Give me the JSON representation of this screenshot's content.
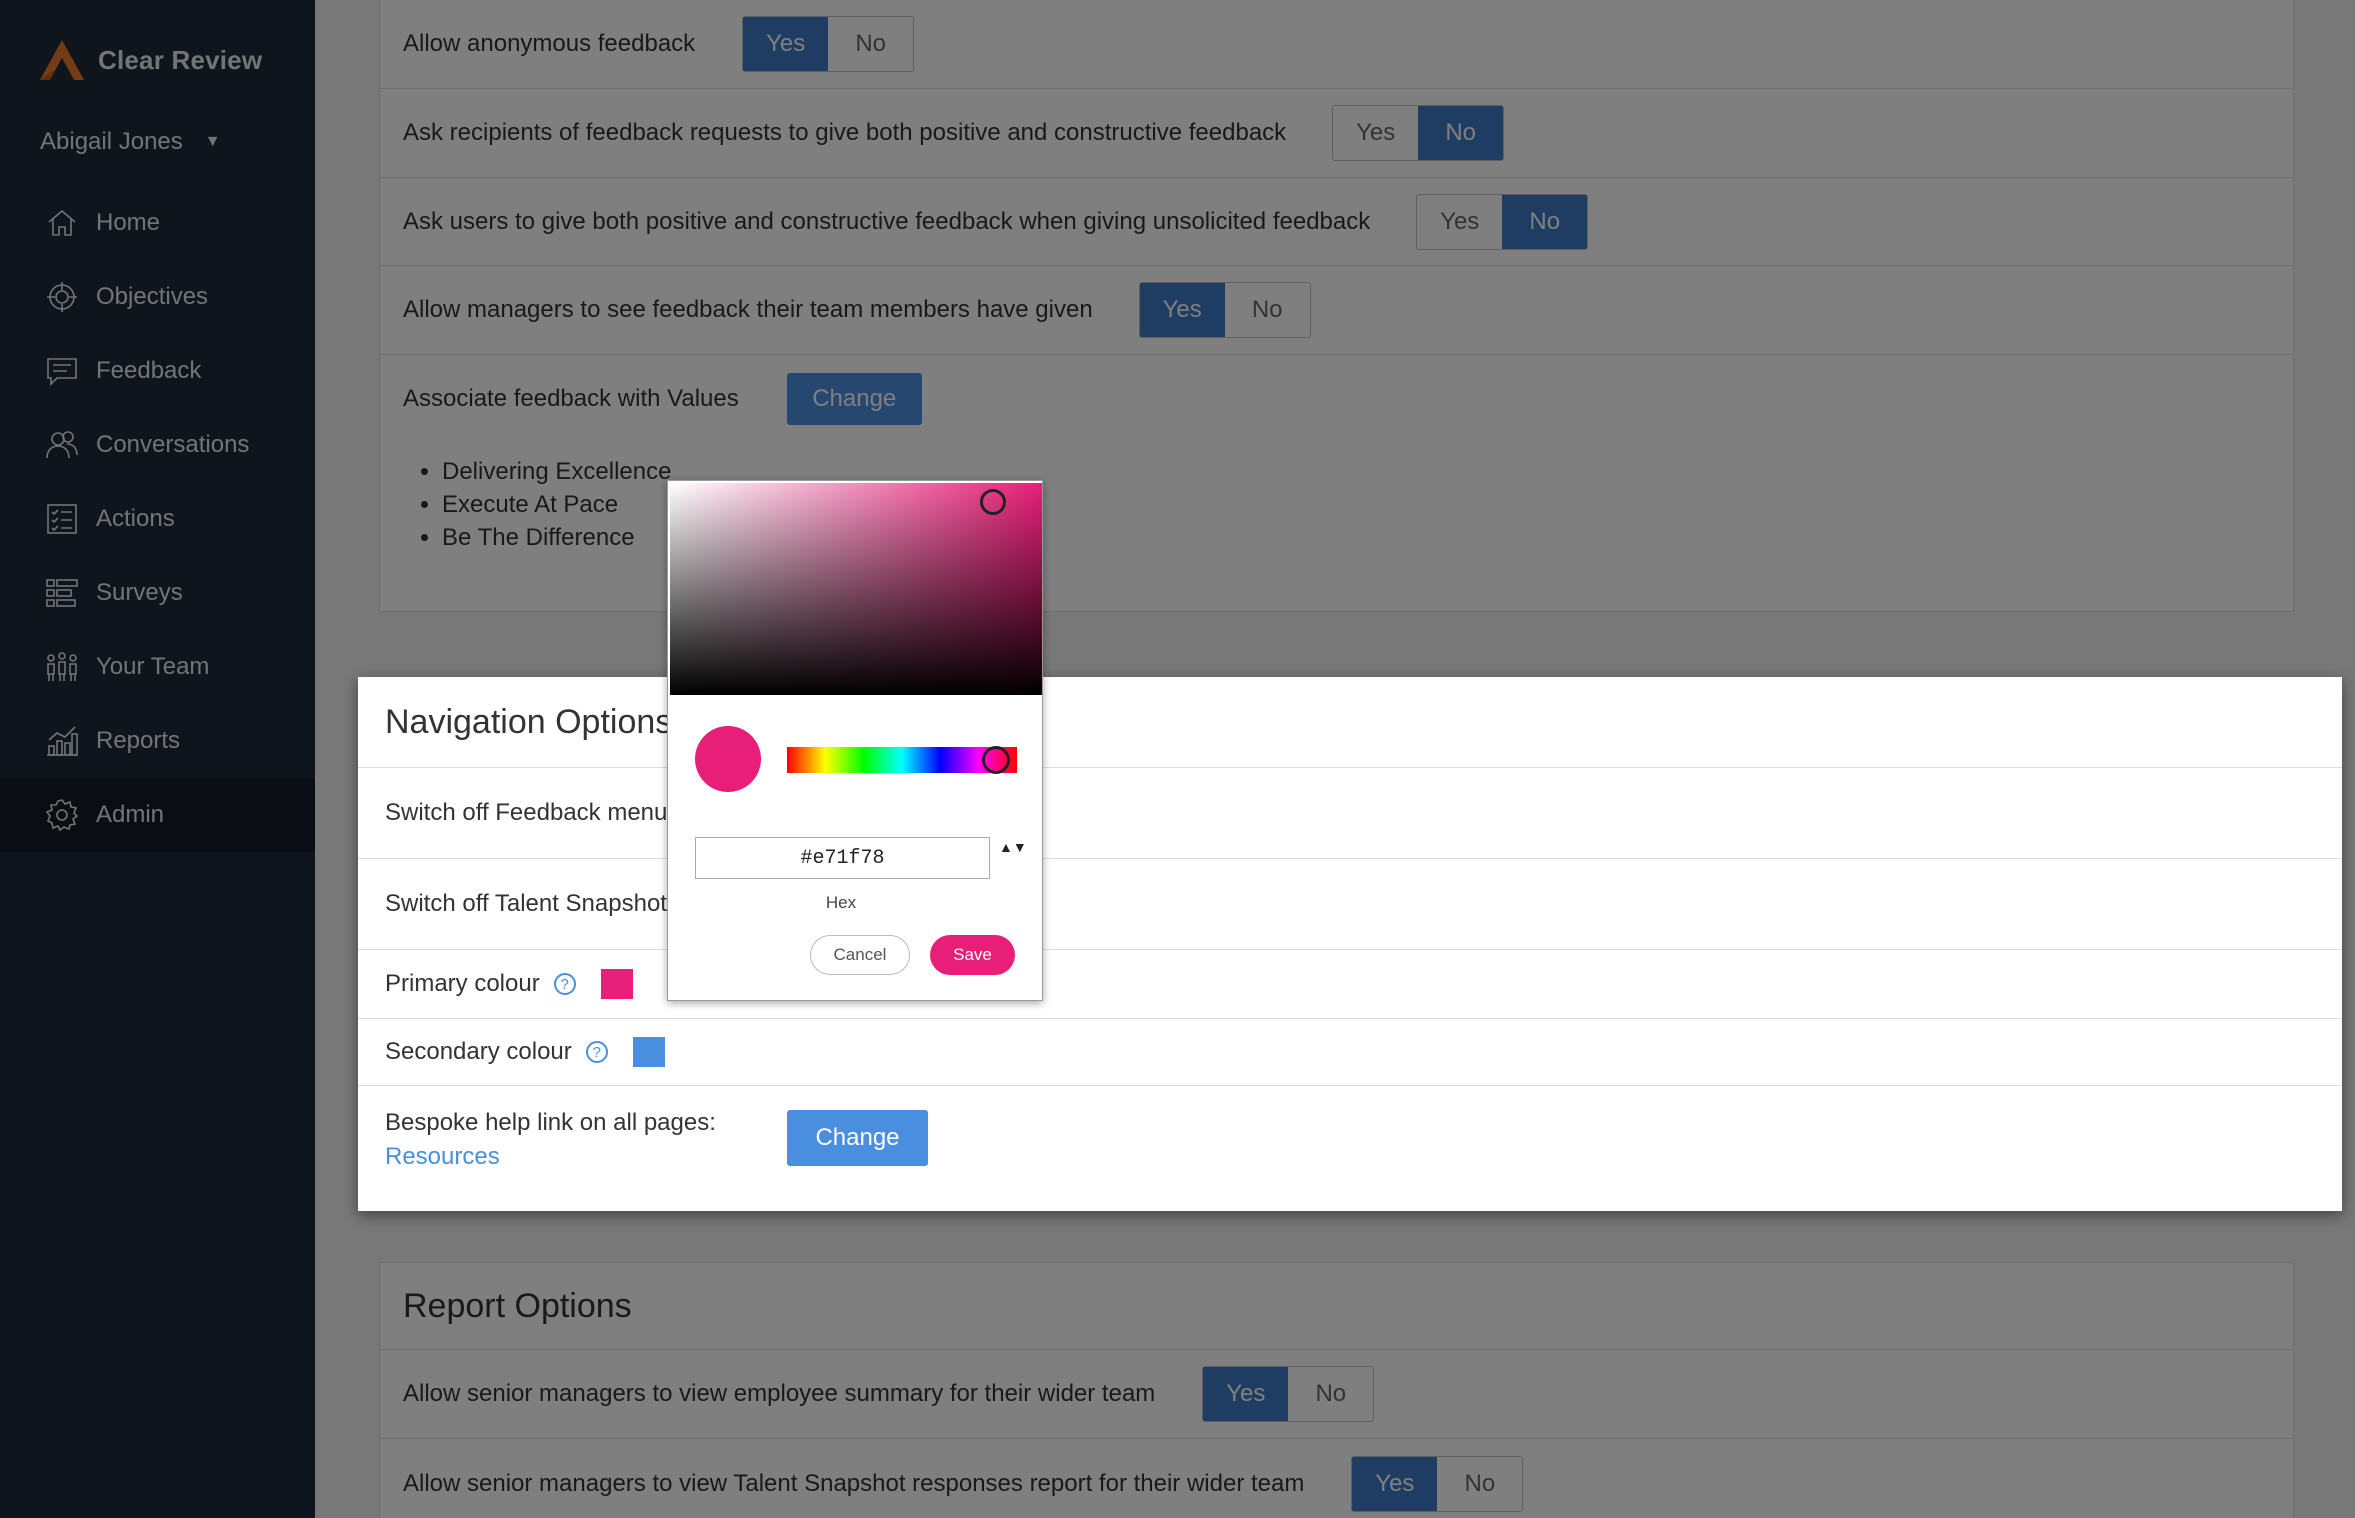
{
  "app": {
    "name": "Clear Review"
  },
  "user": {
    "name": "Abigail Jones"
  },
  "sidebar": {
    "items": [
      {
        "label": "Home",
        "icon": "home-icon"
      },
      {
        "label": "Objectives",
        "icon": "target-icon"
      },
      {
        "label": "Feedback",
        "icon": "feedback-icon"
      },
      {
        "label": "Conversations",
        "icon": "conversations-icon"
      },
      {
        "label": "Actions",
        "icon": "checklist-icon"
      },
      {
        "label": "Surveys",
        "icon": "surveys-icon"
      },
      {
        "label": "Your Team",
        "icon": "team-icon"
      },
      {
        "label": "Reports",
        "icon": "reports-icon"
      },
      {
        "label": "Admin",
        "icon": "gear-icon",
        "active": true
      }
    ]
  },
  "feedback_options": {
    "rows": [
      {
        "label": "Allow anonymous feedback",
        "yes": "Yes",
        "no": "No",
        "selected": "Yes"
      },
      {
        "label": "Ask recipients of feedback requests to give both positive and constructive feedback",
        "yes": "Yes",
        "no": "No",
        "selected": "No"
      },
      {
        "label": "Ask users to give both positive and constructive feedback when giving unsolicited feedback",
        "yes": "Yes",
        "no": "No",
        "selected": "No"
      },
      {
        "label": "Allow managers to see feedback their team members have given",
        "yes": "Yes",
        "no": "No",
        "selected": "Yes"
      }
    ],
    "values_row": {
      "label": "Associate feedback with Values",
      "button": "Change"
    },
    "values": [
      "Delivering Excellence",
      "Execute At Pace",
      "Be The Difference"
    ]
  },
  "navigation_options": {
    "title": "Navigation Options",
    "feedback_row": "Switch off Feedback menu",
    "talent_row": "Switch off Talent Snapshot",
    "primary_colour_label": "Primary colour",
    "secondary_colour_label": "Secondary colour",
    "help_link_label": "Bespoke help link on all pages:",
    "help_link_text": "Resources",
    "change_button": "Change",
    "help_icon": "?"
  },
  "colors": {
    "primary": "#e71f78",
    "secondary": "#4a8ee0",
    "toggle_selected": "#3f7ac7"
  },
  "color_picker": {
    "hex_value": "#e71f78",
    "hex_label": "Hex",
    "cancel": "Cancel",
    "save": "Save",
    "arrows": "▲▼"
  },
  "report_options": {
    "title": "Report Options",
    "rows": [
      {
        "label": "Allow senior managers to view employee summary for their wider team",
        "yes": "Yes",
        "no": "No",
        "selected": "Yes"
      },
      {
        "label": "Allow senior managers to view Talent Snapshot responses report for their wider team",
        "yes": "Yes",
        "no": "No",
        "selected": "Yes"
      }
    ]
  }
}
